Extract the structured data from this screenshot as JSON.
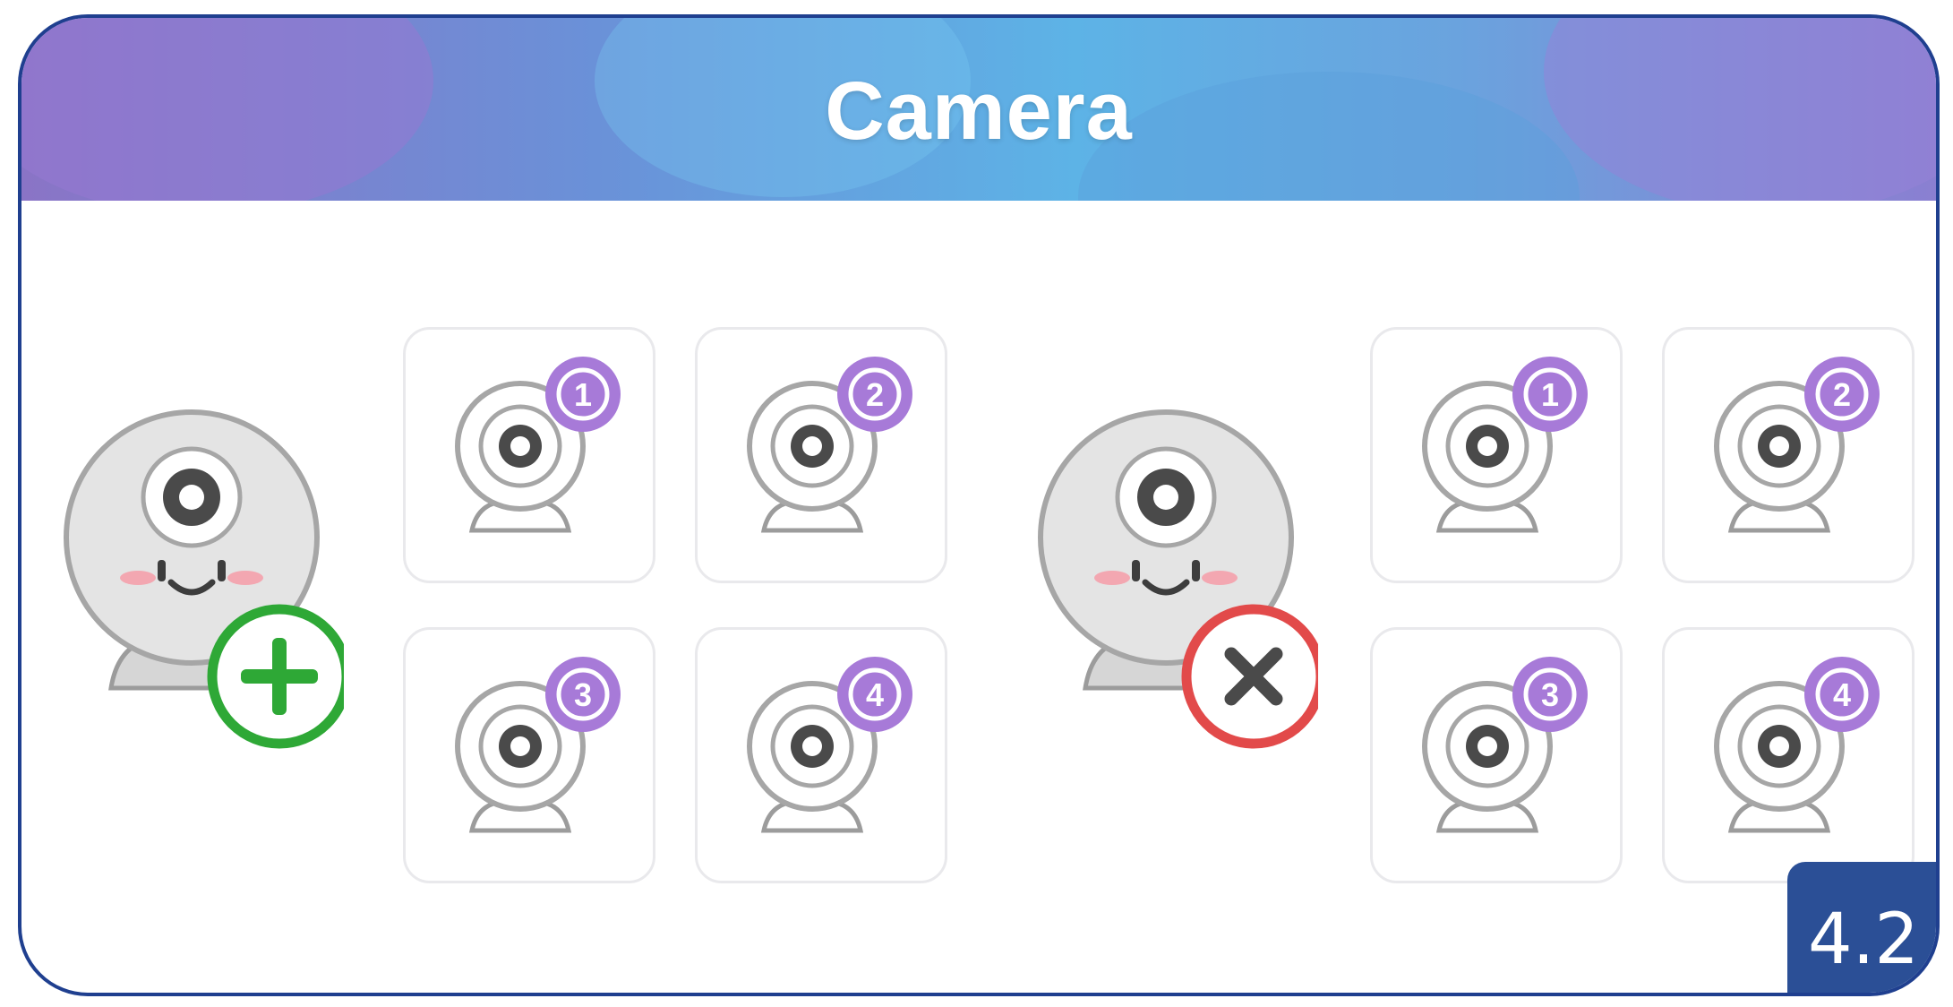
{
  "header": {
    "title": "Camera"
  },
  "add_group": {
    "action_icon": "plus-icon",
    "action_color": "#2ea836",
    "slots": [
      "1",
      "2",
      "3",
      "4"
    ]
  },
  "remove_group": {
    "action_icon": "x-icon",
    "action_color": "#e24a4a",
    "slots": [
      "1",
      "2",
      "3",
      "4"
    ]
  },
  "badge_color": "#a77ad8",
  "version": "4.2"
}
